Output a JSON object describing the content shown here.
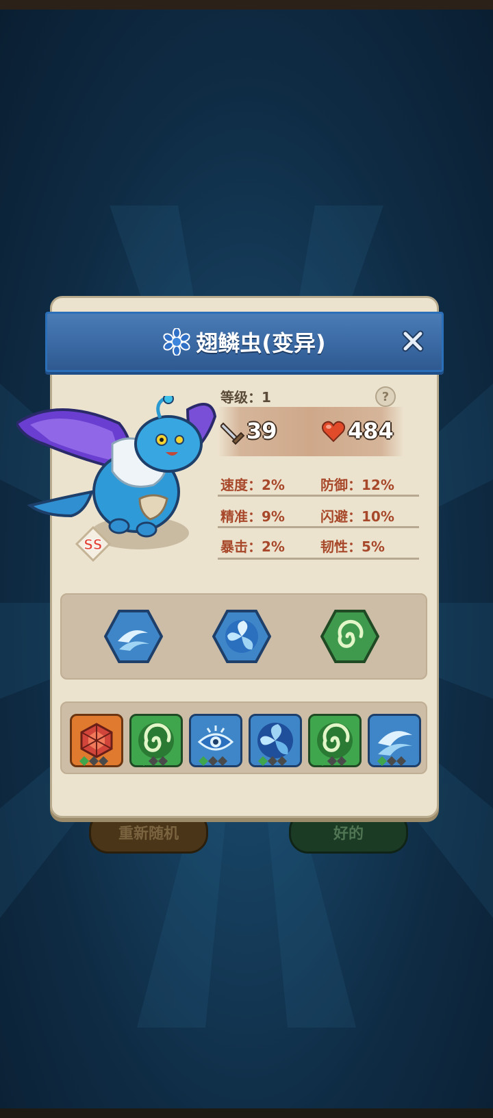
{
  "dialog": {
    "title": "翅鳞虫(变异)",
    "level_label": "等级：1",
    "attack": "39",
    "hp": "484",
    "stats": [
      {
        "left": "速度：2%",
        "right": "防御：12%"
      },
      {
        "left": "精准：9%",
        "right": "闪避：10%"
      },
      {
        "left": "暴击：2%",
        "right": "韧性：5%"
      }
    ],
    "help_label": "?",
    "rank": "SS"
  },
  "skills": [
    {
      "icon": "wave-skill-icon",
      "color": "#3f86c8"
    },
    {
      "icon": "water-orb-skill-icon",
      "color": "#3f86c8"
    },
    {
      "icon": "wind-swirl-skill-icon",
      "color": "#3f9a4e"
    }
  ],
  "gems": [
    {
      "icon": "hexagon-crystal-icon",
      "color": "#e07a2e"
    },
    {
      "icon": "green-swirl-icon",
      "color": "#3fa64e"
    },
    {
      "icon": "eye-icon",
      "color": "#3f86c8"
    },
    {
      "icon": "blue-orb-icon",
      "color": "#3f86c8"
    },
    {
      "icon": "green-swirl-icon",
      "color": "#3fa64e"
    },
    {
      "icon": "wave-icon",
      "color": "#3f86c8"
    }
  ],
  "buttons": {
    "reroll": "重新随机",
    "ok": "好的"
  }
}
